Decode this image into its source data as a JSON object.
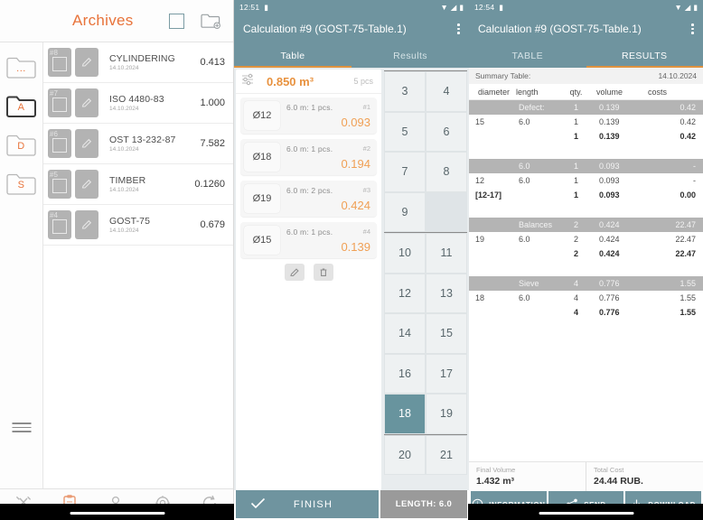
{
  "archives": {
    "title": "Archives",
    "select_all_icon": "checkbox-square-icon",
    "new_folder_icon": "new-folder-icon",
    "menu_icon": "hamburger-menu-icon",
    "folders": [
      {
        "label": "...",
        "name": "folder-recent",
        "selected": false
      },
      {
        "label": "A",
        "name": "folder-archive",
        "selected": true
      },
      {
        "label": "D",
        "name": "folder-drafts",
        "selected": false
      },
      {
        "label": "S",
        "name": "folder-saved",
        "selected": false
      }
    ],
    "items": [
      {
        "num": "#8",
        "name": "CYLINDERING",
        "date": "14.10.2024",
        "value": "0.413"
      },
      {
        "num": "#7",
        "name": "ISO 4480-83",
        "date": "14.10.2024",
        "value": "1.000"
      },
      {
        "num": "#6",
        "name": "OST 13-232-87",
        "date": "14.10.2024",
        "value": "7.582"
      },
      {
        "num": "#5",
        "name": "TIMBER",
        "date": "14.10.2024",
        "value": "0.1260"
      },
      {
        "num": "#4",
        "name": "GOST-75",
        "date": "14.10.2024",
        "value": "0.679"
      }
    ],
    "tabbar": [
      {
        "icon": "tools-icon",
        "name": "tab-tools",
        "active": false
      },
      {
        "icon": "clipboard-icon",
        "name": "tab-archives",
        "active": true
      },
      {
        "icon": "person-icon",
        "name": "tab-profile",
        "active": false
      },
      {
        "icon": "gear-icon",
        "name": "tab-settings",
        "active": false
      },
      {
        "icon": "history-refresh-icon",
        "name": "tab-history",
        "active": false
      }
    ]
  },
  "calc": {
    "status": {
      "clock": "12:51",
      "battery_icon": "battery-icon",
      "wifi_icon": "wifi-icon",
      "signal_icon": "signal-icon"
    },
    "title": "Calculation #9 (GOST-75-Table.1)",
    "overflow_icon": "kebab-menu-icon",
    "tabs": [
      {
        "label": "Table",
        "selected": true
      },
      {
        "label": "Results",
        "selected": false
      }
    ],
    "volume": {
      "icon": "sliders-icon",
      "value": "0.850 m³",
      "count": "5 pcs"
    },
    "items": [
      {
        "diameter": "Ø12",
        "info": "6.0 m:  1 pcs.",
        "index": "#1",
        "volume": "0.093"
      },
      {
        "diameter": "Ø18",
        "info": "6.0 m:  1 pcs.",
        "index": "#2",
        "volume": "0.194"
      },
      {
        "diameter": "Ø19",
        "info": "6.0 m:  2 pcs.",
        "index": "#3",
        "volume": "0.424"
      },
      {
        "diameter": "Ø15",
        "info": "6.0 m:  1 pcs.",
        "index": "#4",
        "volume": "0.139"
      }
    ],
    "row_actions": [
      {
        "icon": "pencil-edit-icon",
        "name": "edit-item-button"
      },
      {
        "icon": "trash-delete-icon",
        "name": "delete-item-button"
      }
    ],
    "keypad_groups": [
      {
        "rows": [
          [
            "3",
            "4"
          ],
          [
            "5",
            "6"
          ],
          [
            "7",
            "8"
          ],
          [
            "9",
            ""
          ]
        ]
      },
      {
        "rows": [
          [
            "10",
            "11"
          ],
          [
            "12",
            "13"
          ],
          [
            "14",
            "15"
          ],
          [
            "16",
            "17"
          ],
          [
            "18",
            "19"
          ]
        ]
      },
      {
        "rows": [
          [
            "20",
            "21"
          ]
        ]
      }
    ],
    "keypad_selected": "18",
    "finish_label": "FINISH",
    "finish_icon": "check-icon",
    "length_label": "LENGTH: 6.0"
  },
  "results": {
    "status": {
      "clock": "12:54",
      "battery_icon": "battery-icon",
      "wifi_icon": "wifi-icon",
      "signal_icon": "signal-icon"
    },
    "title": "Calculation #9 (GOST-75-Table.1)",
    "overflow_icon": "kebab-menu-icon",
    "tabs": [
      {
        "label": "TABLE",
        "selected": false
      },
      {
        "label": "RESULTS",
        "selected": true
      }
    ],
    "summary_label": "Summary Table:",
    "summary_date": "14.10.2024",
    "columns": [
      "diameter",
      "length",
      "qty.",
      "volume",
      "costs"
    ],
    "blocks": [
      {
        "group": [
          "",
          "Defect:",
          "1",
          "0.139",
          "0.42"
        ],
        "rows": [
          [
            "15",
            "6.0",
            "1",
            "0.139",
            "0.42"
          ]
        ],
        "total": [
          "",
          "",
          "1",
          "0.139",
          "0.42"
        ]
      },
      {
        "group": [
          "",
          "6.0",
          "1",
          "0.093",
          "-"
        ],
        "rows": [
          [
            "12",
            "6.0",
            "1",
            "0.093",
            "-"
          ]
        ],
        "total": [
          "[12-17]",
          "",
          "1",
          "0.093",
          "0.00"
        ]
      },
      {
        "group": [
          "",
          "Balances",
          "2",
          "0.424",
          "22.47"
        ],
        "rows": [
          [
            "19",
            "6.0",
            "2",
            "0.424",
            "22.47"
          ]
        ],
        "total": [
          "",
          "",
          "2",
          "0.424",
          "22.47"
        ]
      },
      {
        "group": [
          "",
          "Sieve",
          "4",
          "0.776",
          "1.55"
        ],
        "rows": [
          [
            "18",
            "6.0",
            "4",
            "0.776",
            "1.55"
          ]
        ],
        "total": [
          "",
          "",
          "4",
          "0.776",
          "1.55"
        ]
      }
    ],
    "final_volume_label": "Final Volume",
    "final_volume_value": "1.432 m³",
    "total_cost_label": "Total Cost",
    "total_cost_value": "24.44 RUB.",
    "actions": [
      {
        "label": "INFORMATION",
        "icon": "info-circle-icon",
        "name": "information-button"
      },
      {
        "label": "SEND",
        "icon": "share-icon",
        "name": "send-button"
      },
      {
        "label": "DOWNLOAD",
        "icon": "download-icon",
        "name": "download-button"
      }
    ]
  },
  "theme": {
    "accent_orange": "#e8733a",
    "teal": "#6f949f",
    "value_orange": "#f0a055",
    "group_gray": "#b4b4b4"
  }
}
